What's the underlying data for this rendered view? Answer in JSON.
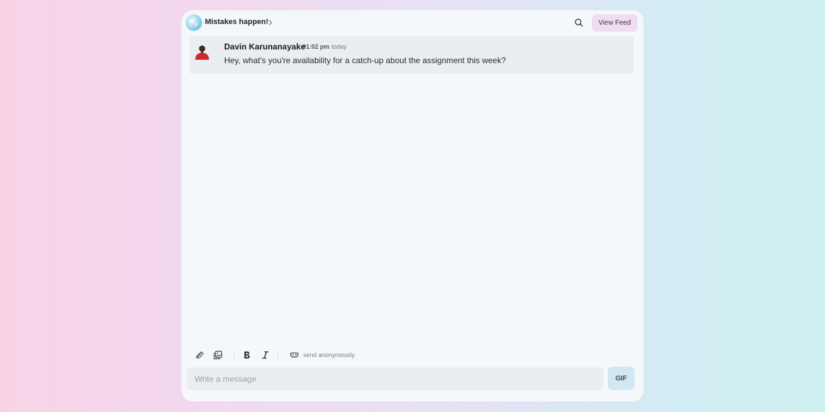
{
  "header": {
    "group_title": "Mistakes happen!",
    "chevron_icon": "chevron-right-icon",
    "search_icon": "search-icon",
    "view_feed_label": "View Feed"
  },
  "messages": [
    {
      "author": "Davin Karunanayake",
      "time": "01:02 pm",
      "day": "today",
      "text": "Hey, what's you're availability for a catch-up about the assignment this week?"
    }
  ],
  "toolbar": {
    "icons": [
      "paperclip-icon",
      "image-icon",
      "bold-icon",
      "italic-icon",
      "mask-icon"
    ],
    "bold_label": "B",
    "italic_label": "I",
    "anonymous_label": "send anonymously"
  },
  "composer": {
    "placeholder": "Write a message",
    "value": "",
    "gif_label": "GIF"
  },
  "colors": {
    "view_feed_bg": "#efdcf0",
    "gif_bg": "#d2e7f3",
    "message_bg": "#ebeef1",
    "card_bg": "#f5f8fb"
  }
}
